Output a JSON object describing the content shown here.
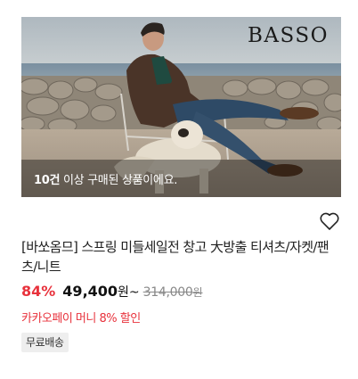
{
  "product": {
    "brand_logo_text": "BASSO",
    "overlay": {
      "count": "10건",
      "suffix": " 이상 구매된 상품이에요."
    },
    "title": "[바쏘옴므] 스프링 미들세일전 창고 大방출 티셔츠/자켓/팬츠/니트",
    "discount": "84%",
    "price": "49,400",
    "price_unit": "원~",
    "original_price": "314,000",
    "original_unit": "원",
    "promo": "카카오페이 머니 8% 할인",
    "badge": "무료배송",
    "colors": {
      "discount": "#e8323c",
      "promo": "#e8323c"
    },
    "wishlist_icon": "heart-outline-icon"
  }
}
